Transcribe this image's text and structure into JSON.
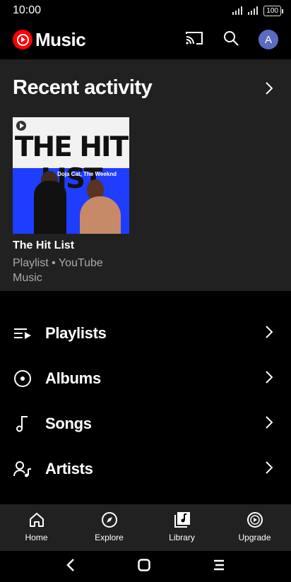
{
  "status_bar": {
    "time": "10:00",
    "battery": "100"
  },
  "app": {
    "name": "Music",
    "avatar_letter": "A"
  },
  "recent": {
    "title": "Recent activity",
    "card": {
      "thumb_title": "THE HIT LIST",
      "thumb_artists": "Doja Cat, The Weeknd",
      "name": "The Hit List",
      "subtitle": "Playlist • YouTube Music"
    }
  },
  "library": [
    {
      "label": "Playlists",
      "icon": "playlist-icon"
    },
    {
      "label": "Albums",
      "icon": "album-icon"
    },
    {
      "label": "Songs",
      "icon": "music-note-icon"
    },
    {
      "label": "Artists",
      "icon": "artist-icon"
    }
  ],
  "bottom_nav": [
    {
      "label": "Home",
      "icon": "home-icon"
    },
    {
      "label": "Explore",
      "icon": "compass-icon"
    },
    {
      "label": "Library",
      "icon": "library-icon",
      "selected": true
    },
    {
      "label": "Upgrade",
      "icon": "upgrade-icon"
    }
  ],
  "colors": {
    "brand": "#ff0000",
    "surface": "#212121",
    "background": "#000000",
    "muted_text": "#aaaaaa",
    "avatar": "#5c6bc0"
  }
}
